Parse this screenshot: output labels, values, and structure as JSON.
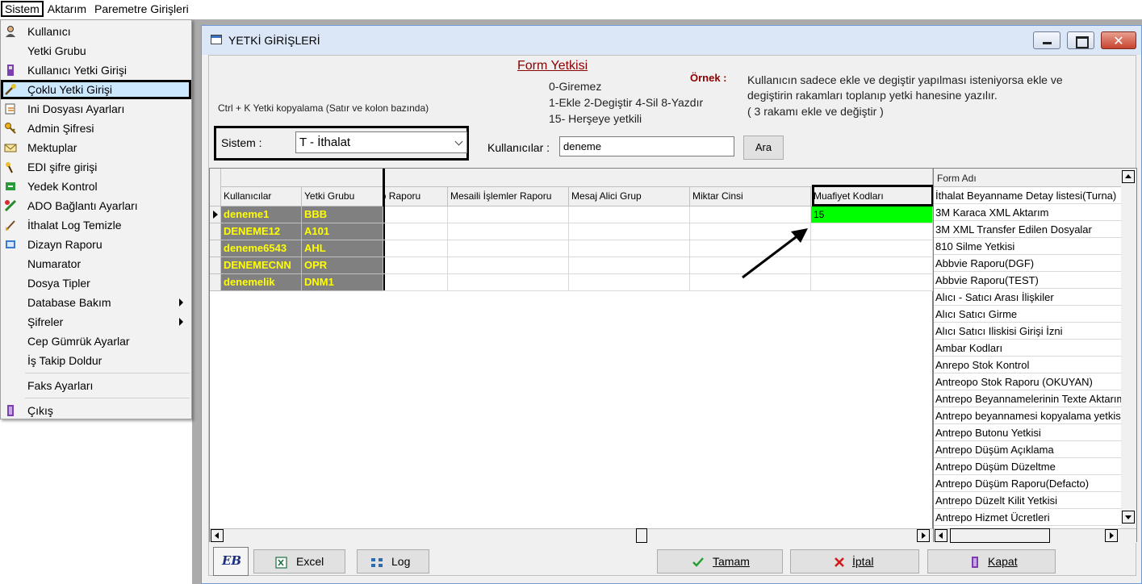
{
  "menubar": {
    "items": [
      "Sistem",
      "Aktarım",
      "Paremetre Girişleri"
    ]
  },
  "sistem_menu": {
    "items": [
      {
        "label": "Kullanıcı",
        "icon": "user-icon"
      },
      {
        "label": "Yetki Grubu",
        "icon": ""
      },
      {
        "label": "Kullanıcı Yetki Girişi",
        "icon": "user-permission-icon"
      },
      {
        "label": "Çoklu Yetki Girişi",
        "icon": "key-pen-icon"
      },
      {
        "label": "Ini Dosyası  Ayarları",
        "icon": "ini-file-icon"
      },
      {
        "label": "Admin Şifresi",
        "icon": "key-icon"
      },
      {
        "label": "Mektuplar",
        "icon": "letter-icon"
      },
      {
        "label": "EDI şifre girişi",
        "icon": "edi-key-icon"
      },
      {
        "label": "Yedek Kontrol",
        "icon": "backup-icon"
      },
      {
        "label": "ADO Bağlantı Ayarları",
        "icon": "connection-icon"
      },
      {
        "label": "İthalat Log Temizle",
        "icon": "broom-icon"
      },
      {
        "label": "Dizayn Raporu",
        "icon": "report-icon"
      },
      {
        "label": "Numarator",
        "icon": ""
      },
      {
        "label": "Dosya Tipler",
        "icon": ""
      },
      {
        "label": "Database Bakım",
        "icon": ""
      },
      {
        "label": "Şifreler",
        "icon": ""
      },
      {
        "label": "Cep Gümrük Ayarlar",
        "icon": ""
      },
      {
        "label": "İş Takip Doldur",
        "icon": ""
      },
      {
        "label": "Faks Ayarları",
        "icon": ""
      },
      {
        "label": "Çıkış",
        "icon": "exit-icon"
      }
    ]
  },
  "window": {
    "title": "YETKİ GİRİŞLERİ",
    "close_glyph": "✕"
  },
  "info": {
    "form_yetkisi": "Form Yetkisi",
    "ornek": "Örnek :",
    "code_0": "0-Giremez",
    "code_1": "1-Ekle  2-Degiştir  4-Sil  8-Yazdır",
    "code_15": "15- Herşeye yetkili",
    "desc_1": "Kullanıcın sadece ekle ve degiştir yapılması isteniyorsa  ekle ve",
    "desc_2": "degiştirin rakamları toplanıp yetki hanesine yazılır.",
    "desc_3": " ( 3 rakamı ekle ve değiştir )",
    "ctrl_k": "Ctrl + K Yetki kopyalama (Satır ve kolon bazında)"
  },
  "filters": {
    "sistem_label": "Sistem :",
    "sistem_value": "T - İthalat",
    "kullanicilar_label": "Kullanıcılar :",
    "kullanicilar_value": "deneme",
    "ara_label": "Ara"
  },
  "grid": {
    "columns": [
      "Kullanıcılar",
      "Yetki Grubu",
      "İş Takip Raporu",
      "Mesaili İşlemler Raporu",
      "Mesaj Alici Grup",
      "Miktar Cinsi",
      "Muafiyet Kodları"
    ],
    "rows": [
      {
        "user": "deneme1",
        "group": "BBB",
        "muaf": "15"
      },
      {
        "user": "DENEME12",
        "group": "A101",
        "muaf": ""
      },
      {
        "user": "deneme6543",
        "group": "AHL",
        "muaf": ""
      },
      {
        "user": "DENEMECNN",
        "group": "OPR",
        "muaf": ""
      },
      {
        "user": "denemelik",
        "group": "DNM1",
        "muaf": ""
      }
    ],
    "highlight_color": "#00ff00",
    "fixed_col_color": "#808080",
    "fixed_text_color": "#ffff00"
  },
  "form_list": {
    "header": "Form Adı",
    "items": [
      "İthalat Beyanname Detay listesi(Turna)",
      "3M Karaca XML Aktarım",
      "3M XML Transfer Edilen Dosyalar",
      "810 Silme Yetkisi",
      "Abbvie Raporu(DGF)",
      "Abbvie Raporu(TEST)",
      "Alıcı - Satıcı Arası İlişkiler",
      "Alıcı Satıcı Girme",
      "Alıcı Satıcı Iliskisi Girişi İzni",
      "Ambar Kodları",
      "Anrepo Stok Kontrol",
      "Antreopo Stok Raporu (OKUYAN)",
      "Antrepo Beyannamelerinin Texte Aktarımı",
      "Antrepo beyannamesi kopyalama yetkisi",
      "Antrepo Butonu Yetkisi",
      "Antrepo Düşüm Açıklama",
      "Antrepo Düşüm Düzeltme",
      "Antrepo Düşüm Raporu(Defacto)",
      "Antrepo Düzelt Kilit Yetkisi",
      "Antrepo Hizmet Ücretleri"
    ]
  },
  "buttons": {
    "eb_label": "EB",
    "excel": "Excel",
    "log": "Log",
    "tamam": "Tamam",
    "iptal": "İptal",
    "kapat": "Kapat"
  }
}
